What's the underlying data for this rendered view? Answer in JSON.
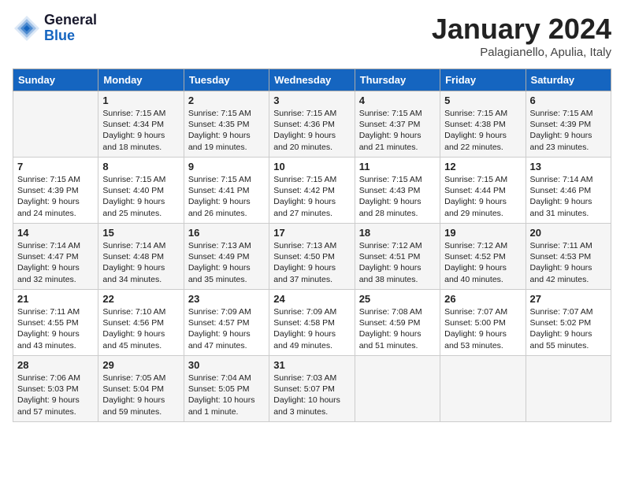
{
  "header": {
    "logo_general": "General",
    "logo_blue": "Blue",
    "month_title": "January 2024",
    "location": "Palagianello, Apulia, Italy"
  },
  "days_of_week": [
    "Sunday",
    "Monday",
    "Tuesday",
    "Wednesday",
    "Thursday",
    "Friday",
    "Saturday"
  ],
  "weeks": [
    [
      {
        "day": "",
        "content": ""
      },
      {
        "day": "1",
        "content": "Sunrise: 7:15 AM\nSunset: 4:34 PM\nDaylight: 9 hours\nand 18 minutes."
      },
      {
        "day": "2",
        "content": "Sunrise: 7:15 AM\nSunset: 4:35 PM\nDaylight: 9 hours\nand 19 minutes."
      },
      {
        "day": "3",
        "content": "Sunrise: 7:15 AM\nSunset: 4:36 PM\nDaylight: 9 hours\nand 20 minutes."
      },
      {
        "day": "4",
        "content": "Sunrise: 7:15 AM\nSunset: 4:37 PM\nDaylight: 9 hours\nand 21 minutes."
      },
      {
        "day": "5",
        "content": "Sunrise: 7:15 AM\nSunset: 4:38 PM\nDaylight: 9 hours\nand 22 minutes."
      },
      {
        "day": "6",
        "content": "Sunrise: 7:15 AM\nSunset: 4:39 PM\nDaylight: 9 hours\nand 23 minutes."
      }
    ],
    [
      {
        "day": "7",
        "content": "Sunrise: 7:15 AM\nSunset: 4:39 PM\nDaylight: 9 hours\nand 24 minutes."
      },
      {
        "day": "8",
        "content": "Sunrise: 7:15 AM\nSunset: 4:40 PM\nDaylight: 9 hours\nand 25 minutes."
      },
      {
        "day": "9",
        "content": "Sunrise: 7:15 AM\nSunset: 4:41 PM\nDaylight: 9 hours\nand 26 minutes."
      },
      {
        "day": "10",
        "content": "Sunrise: 7:15 AM\nSunset: 4:42 PM\nDaylight: 9 hours\nand 27 minutes."
      },
      {
        "day": "11",
        "content": "Sunrise: 7:15 AM\nSunset: 4:43 PM\nDaylight: 9 hours\nand 28 minutes."
      },
      {
        "day": "12",
        "content": "Sunrise: 7:15 AM\nSunset: 4:44 PM\nDaylight: 9 hours\nand 29 minutes."
      },
      {
        "day": "13",
        "content": "Sunrise: 7:14 AM\nSunset: 4:46 PM\nDaylight: 9 hours\nand 31 minutes."
      }
    ],
    [
      {
        "day": "14",
        "content": "Sunrise: 7:14 AM\nSunset: 4:47 PM\nDaylight: 9 hours\nand 32 minutes."
      },
      {
        "day": "15",
        "content": "Sunrise: 7:14 AM\nSunset: 4:48 PM\nDaylight: 9 hours\nand 34 minutes."
      },
      {
        "day": "16",
        "content": "Sunrise: 7:13 AM\nSunset: 4:49 PM\nDaylight: 9 hours\nand 35 minutes."
      },
      {
        "day": "17",
        "content": "Sunrise: 7:13 AM\nSunset: 4:50 PM\nDaylight: 9 hours\nand 37 minutes."
      },
      {
        "day": "18",
        "content": "Sunrise: 7:12 AM\nSunset: 4:51 PM\nDaylight: 9 hours\nand 38 minutes."
      },
      {
        "day": "19",
        "content": "Sunrise: 7:12 AM\nSunset: 4:52 PM\nDaylight: 9 hours\nand 40 minutes."
      },
      {
        "day": "20",
        "content": "Sunrise: 7:11 AM\nSunset: 4:53 PM\nDaylight: 9 hours\nand 42 minutes."
      }
    ],
    [
      {
        "day": "21",
        "content": "Sunrise: 7:11 AM\nSunset: 4:55 PM\nDaylight: 9 hours\nand 43 minutes."
      },
      {
        "day": "22",
        "content": "Sunrise: 7:10 AM\nSunset: 4:56 PM\nDaylight: 9 hours\nand 45 minutes."
      },
      {
        "day": "23",
        "content": "Sunrise: 7:09 AM\nSunset: 4:57 PM\nDaylight: 9 hours\nand 47 minutes."
      },
      {
        "day": "24",
        "content": "Sunrise: 7:09 AM\nSunset: 4:58 PM\nDaylight: 9 hours\nand 49 minutes."
      },
      {
        "day": "25",
        "content": "Sunrise: 7:08 AM\nSunset: 4:59 PM\nDaylight: 9 hours\nand 51 minutes."
      },
      {
        "day": "26",
        "content": "Sunrise: 7:07 AM\nSunset: 5:00 PM\nDaylight: 9 hours\nand 53 minutes."
      },
      {
        "day": "27",
        "content": "Sunrise: 7:07 AM\nSunset: 5:02 PM\nDaylight: 9 hours\nand 55 minutes."
      }
    ],
    [
      {
        "day": "28",
        "content": "Sunrise: 7:06 AM\nSunset: 5:03 PM\nDaylight: 9 hours\nand 57 minutes."
      },
      {
        "day": "29",
        "content": "Sunrise: 7:05 AM\nSunset: 5:04 PM\nDaylight: 9 hours\nand 59 minutes."
      },
      {
        "day": "30",
        "content": "Sunrise: 7:04 AM\nSunset: 5:05 PM\nDaylight: 10 hours\nand 1 minute."
      },
      {
        "day": "31",
        "content": "Sunrise: 7:03 AM\nSunset: 5:07 PM\nDaylight: 10 hours\nand 3 minutes."
      },
      {
        "day": "",
        "content": ""
      },
      {
        "day": "",
        "content": ""
      },
      {
        "day": "",
        "content": ""
      }
    ]
  ]
}
